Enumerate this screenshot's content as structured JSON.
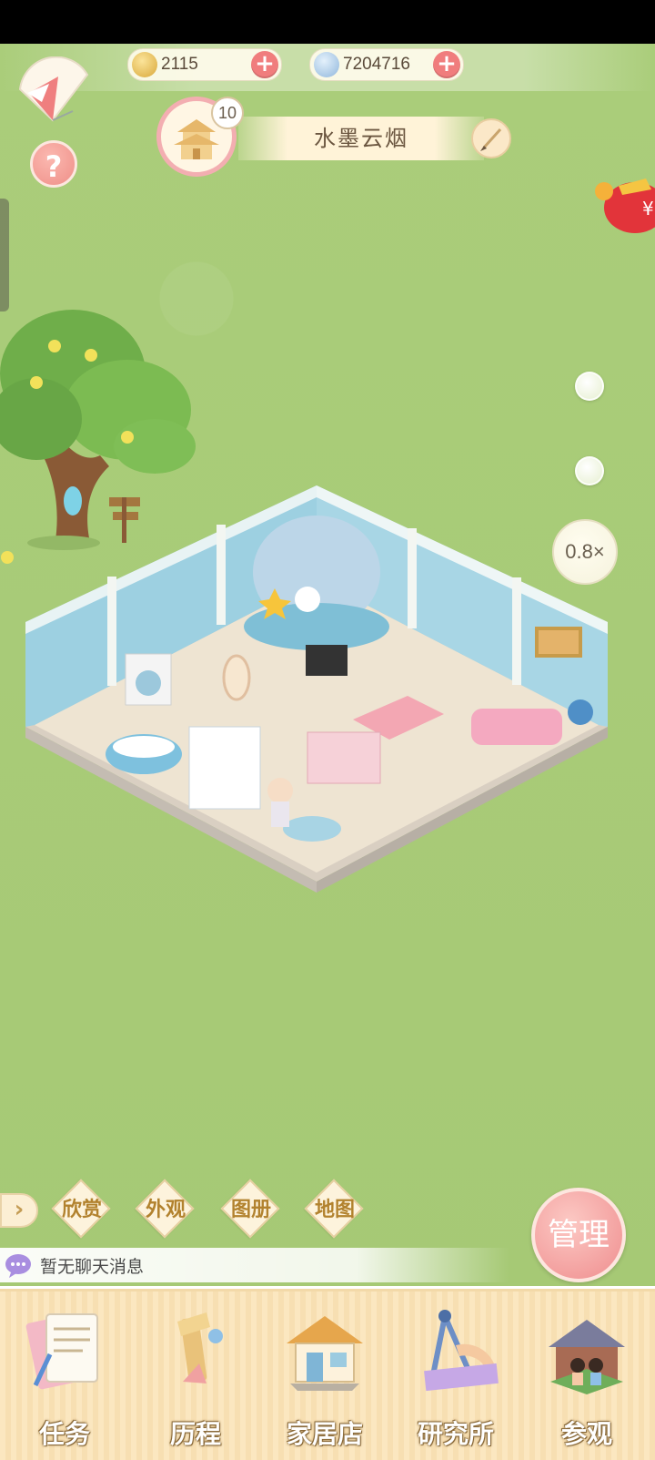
{
  "currencies": {
    "coins": {
      "value": "2115",
      "icon": "gold-coin-icon",
      "color": "#e8c25a"
    },
    "shells": {
      "value": "7204716",
      "icon": "shell-icon",
      "color": "#a9c9e6"
    }
  },
  "house": {
    "level": "10",
    "name": "水墨云烟"
  },
  "zoom": "0.8×",
  "quick_actions": [
    "欣赏",
    "外观",
    "图册",
    "地图"
  ],
  "manage_label": "管理",
  "chat": {
    "placeholder": "暂无聊天消息"
  },
  "bottom_nav": [
    {
      "label": "任务",
      "icon": "task-scroll-icon"
    },
    {
      "label": "历程",
      "icon": "journey-trophy-icon"
    },
    {
      "label": "家居店",
      "icon": "furniture-shop-icon"
    },
    {
      "label": "研究所",
      "icon": "research-compass-icon"
    },
    {
      "label": "参观",
      "icon": "visit-house-icon"
    }
  ],
  "colors": {
    "grass": "#a9cc78",
    "accent_pink": "#ef8d8e",
    "panel": "#fbe7c0"
  }
}
